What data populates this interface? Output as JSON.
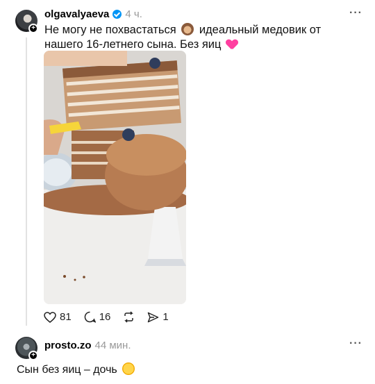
{
  "post": {
    "username": "olgavalyaeva",
    "time": "4 ч.",
    "text_part1": "Не могу не похвастаться",
    "text_part2": "идеальный медовик от нашего 16-летнего сына. Без яиц",
    "icons": [
      "verified-icon",
      "monkey-emoji",
      "pink-heart-emoji",
      "mute-icon"
    ],
    "stats": {
      "likes": "81",
      "comments": "16",
      "shares": "1"
    }
  },
  "reply": {
    "username": "prosto.zo",
    "time": "44 мин.",
    "text": "Сын без яиц – дочь"
  },
  "ui": {
    "more": "···"
  },
  "colors": {
    "verified": "#0095f6",
    "muted_text": "#999999",
    "heart_emoji": "#ff3fa0"
  }
}
